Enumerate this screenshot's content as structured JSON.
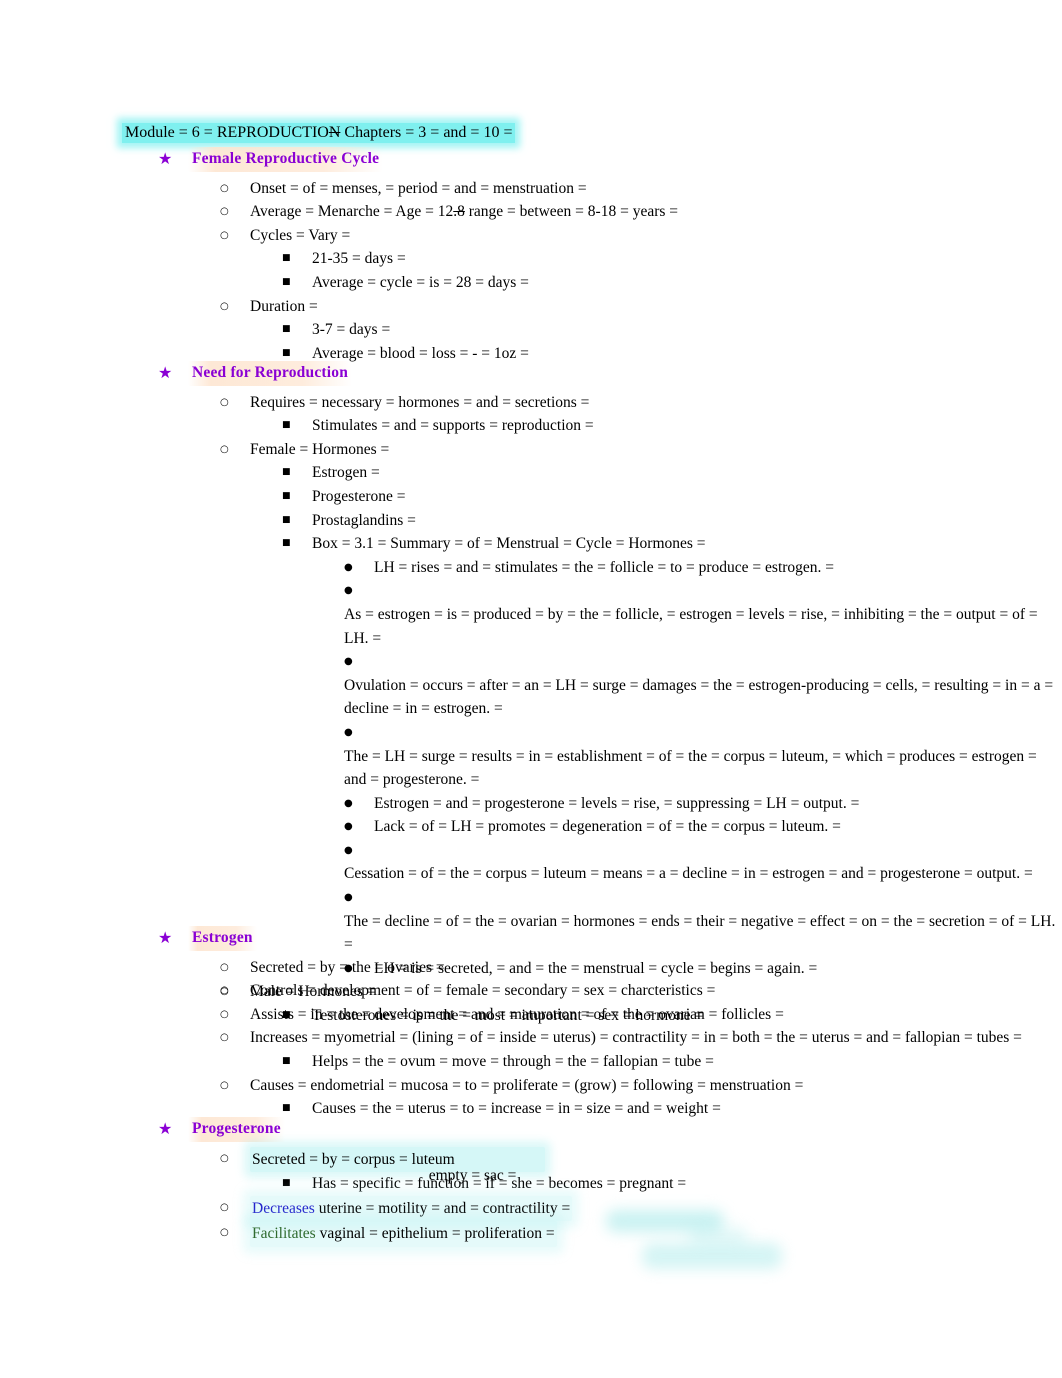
{
  "document": {
    "title_line": "Module = 6 = REPRODUCTION  Chapters = 3 = and = 10 =",
    "title_pre": "Module = 6 = REPRODUCTIO",
    "title_strike": "N",
    "title_post": " Chapters = 3 = and = 10 =",
    "colors": {
      "heading": "#8a00d4",
      "highlight_cyan": "#7ff0ef",
      "highlight_peach": "#fde4ce",
      "blue_word": "#2222cc",
      "green_word": "#2f6b2f",
      "body_text": "#000000"
    },
    "bullets": {
      "star": "★",
      "circle": "○",
      "square": "■",
      "disc": "●"
    }
  },
  "sections": [
    {
      "heading": "Female Reproductive Cycle",
      "items": [
        {
          "level": "circle",
          "text": "Onset = of = menses, = period = and = menstruation ="
        },
        {
          "level": "circle",
          "text_pre": "Average = Menarche = Age = 12",
          "text_strike": ".8",
          "text_post": " range = between = 8-18 = years ="
        },
        {
          "level": "circle",
          "text": "Cycles = Vary ="
        },
        {
          "level": "square",
          "text": "21-35 = days ="
        },
        {
          "level": "square",
          "text": "Average = cycle = is = 28 = days ="
        },
        {
          "level": "circle",
          "text": "Duration ="
        },
        {
          "level": "square",
          "text": "3-7 = days ="
        },
        {
          "level": "square",
          "text": "Average = blood = loss = - = 1oz ="
        }
      ]
    },
    {
      "heading": "Need for Reproduction",
      "items": [
        {
          "level": "circle",
          "text": "Requires = necessary = hormones = and = secretions ="
        },
        {
          "level": "square",
          "text": "Stimulates = and = supports = reproduction ="
        },
        {
          "level": "circle",
          "text": "Female = Hormones ="
        },
        {
          "level": "square",
          "text": "Estrogen ="
        },
        {
          "level": "square",
          "text": "Progesterone ="
        },
        {
          "level": "square",
          "text": "Prostaglandins ="
        },
        {
          "level": "square",
          "text": "Box = 3.1 = Summary = of = Menstrual = Cycle = Hormones ="
        },
        {
          "level": "disc",
          "text": "LH = rises = and = stimulates = the = follicle = to = produce = estrogen. ="
        },
        {
          "level": "disc",
          "text": "As = estrogen = is = produced = by = the = follicle, = estrogen = levels = rise, = inhibiting = the = output = of = LH. ="
        },
        {
          "level": "disc",
          "text": "Ovulation = occurs = after = an = LH = surge = damages = the = estrogen-producing = cells, = resulting = in = a = decline = in = estrogen. ="
        },
        {
          "level": "disc",
          "text": "The = LH = surge = results = in = establishment = of = the = corpus = luteum, = which = produces = estrogen = and = progesterone. ="
        },
        {
          "level": "disc",
          "text": "Estrogen = and = progesterone = levels = rise, = suppressing = LH = output. ="
        },
        {
          "level": "disc",
          "text": "Lack = of = LH = promotes = degeneration = of = the = corpus = luteum. ="
        },
        {
          "level": "disc",
          "text": "Cessation = of = the = corpus = luteum = means = a = decline = in = estrogen = and = progesterone = output. ="
        },
        {
          "level": "disc",
          "text": "The = decline = of = the = ovarian = hormones = ends = their = negative = effect = on = the = secretion = of = LH. ="
        },
        {
          "level": "disc",
          "text": "LH = is = secreted, = and = the = menstrual = cycle = begins = again. ="
        },
        {
          "level": "circle",
          "text": "Male = Hormones ="
        },
        {
          "level": "square",
          "text": "Testosterones = is = the = most = important = sex = hormone ="
        }
      ]
    },
    {
      "heading": "Estrogen",
      "items": [
        {
          "level": "circle",
          "text": "Secreted = by = the = ovaries ="
        },
        {
          "level": "circle",
          "text": "Controls = development = of = female = secondary = sex = charcteristics ="
        },
        {
          "level": "circle",
          "text": "Assists = in = the = development = and = maturation = of = the = ovarian = follicles ="
        },
        {
          "level": "circle",
          "text": "Increases = myometrial = (lining = of = inside = uterus) = contractility = in = both = the = uterus = and = fallopian = tubes ="
        },
        {
          "level": "square",
          "text": "Helps = the = ovum = move = through = the = fallopian = tube ="
        },
        {
          "level": "circle",
          "text": " Causes = endometrial = mucosa = to = proliferate = (grow) = following = menstruation ="
        },
        {
          "level": "square",
          "text": "Causes = the = uterus = to = increase = in = size = and = weight ="
        }
      ]
    },
    {
      "heading": "Progesterone",
      "items": [
        {
          "level": "circle",
          "text_a": "Secreted = by = corpus = luteum",
          "text_b": "empty = sac ="
        },
        {
          "level": "square",
          "text": "Has = specific = function = if = she = becomes = pregnant ="
        },
        {
          "level": "circle",
          "colored_word": "Decreases",
          "color": "blue",
          "text": " uterine = motility = and = contractility ="
        },
        {
          "level": "circle",
          "colored_word": "Facilitates",
          "color": "green",
          "text": " vaginal = epithelium = proliferation ="
        }
      ]
    }
  ]
}
